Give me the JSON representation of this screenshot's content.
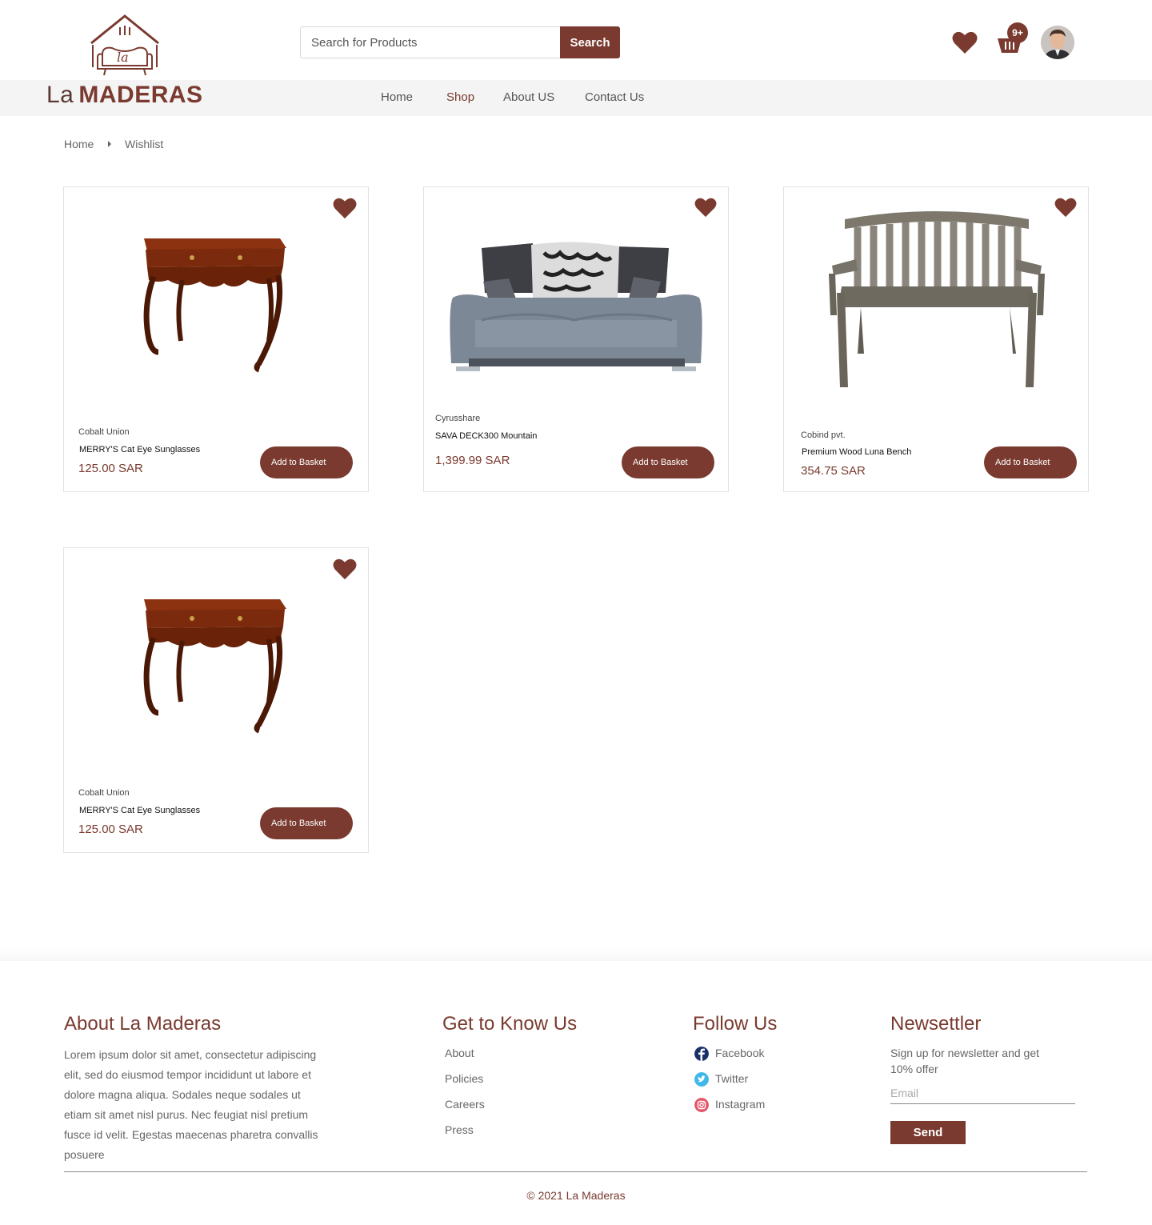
{
  "brand": {
    "name_light": "La",
    "name_bold": "MADERAS",
    "colors": {
      "accent": "#7a3a2f",
      "nav_bg": "#f4f4f4"
    }
  },
  "search": {
    "placeholder": "Search for Products",
    "button_label": "Search"
  },
  "header": {
    "wishlist_icon": "heart-icon",
    "cart_icon": "basket-icon",
    "cart_badge": "9+"
  },
  "nav": {
    "items": [
      {
        "label": "Home"
      },
      {
        "label": "Shop"
      },
      {
        "label": "About US"
      },
      {
        "label": "Contact Us"
      }
    ],
    "active": "Shop"
  },
  "breadcrumb": {
    "items": [
      "Home",
      "Wishlist"
    ]
  },
  "products": [
    {
      "brand": "Cobalt Union",
      "name": "MERRY'S Cat Eye Sunglasses",
      "price": "125.00 SAR",
      "button": "Add to Basket",
      "image": "wooden-console-table"
    },
    {
      "brand": "Cyrusshare",
      "name": "SAVA DECK300 Mountain",
      "price": "1,399.99 SAR",
      "button": "Add to Basket",
      "image": "grey-sofa"
    },
    {
      "brand": "Cobind pvt.",
      "name": "Premium Wood Luna Bench",
      "price": "354.75 SAR",
      "button": "Add to Basket",
      "image": "wooden-bench"
    },
    {
      "brand": "Cobalt Union",
      "name": "MERRY'S Cat Eye Sunglasses",
      "price": "125.00 SAR",
      "button": "Add to Basket",
      "image": "wooden-console-table"
    }
  ],
  "footer": {
    "about": {
      "title": "About La Maderas",
      "text": "Lorem ipsum dolor sit amet, consectetur adipiscing elit, sed do eiusmod tempor incididunt ut labore et dolore magna aliqua. Sodales neque sodales ut etiam sit amet nisl purus. Nec feugiat nisl pretium fusce id velit. Egestas maecenas pharetra convallis posuere"
    },
    "know": {
      "title": "Get to Know Us",
      "links": [
        "About",
        "Policies",
        "Careers",
        "Press"
      ]
    },
    "follow": {
      "title": "Follow Us",
      "links": [
        {
          "label": "Facebook",
          "icon": "facebook-icon",
          "color": "#1b2f6b"
        },
        {
          "label": "Twitter",
          "icon": "twitter-icon",
          "color": "#3fb7e8"
        },
        {
          "label": "Instagram",
          "icon": "instagram-icon",
          "color": "#e4566a"
        }
      ]
    },
    "newsletter": {
      "title": "Newsettler",
      "text": "Sign up for newsletter and get 10% offer",
      "email_placeholder": "Email",
      "button": "Send"
    },
    "copyright": "© 2021 La Maderas"
  }
}
